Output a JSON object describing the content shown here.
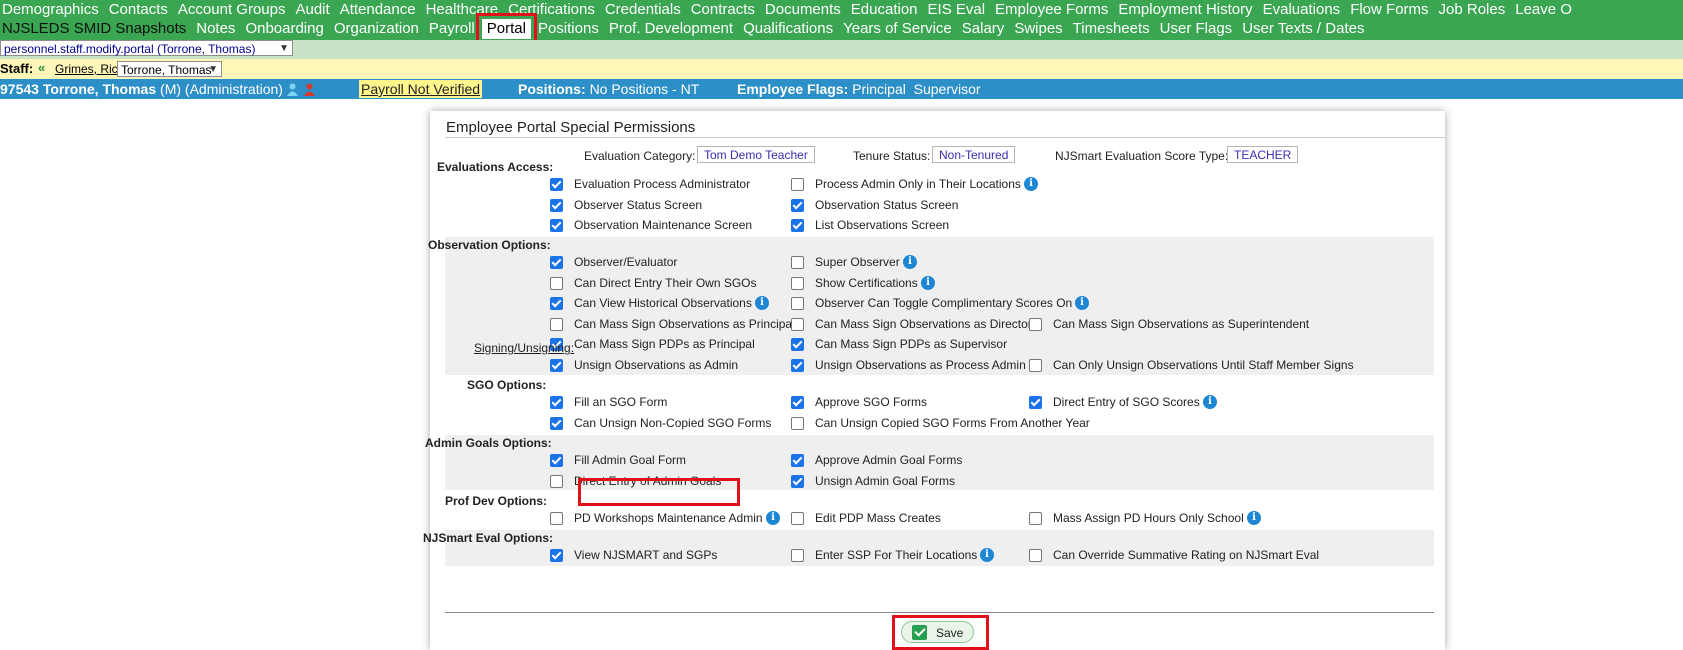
{
  "nav": {
    "row1": [
      "Demographics",
      "Contacts",
      "Account Groups",
      "Audit",
      "Attendance",
      "Healthcare",
      "Certifications",
      "Credentials",
      "Contracts",
      "Documents",
      "Education",
      "EIS Eval",
      "Employee Forms",
      "Employment History",
      "Evaluations",
      "Flow Forms",
      "Job Roles",
      "Leave O"
    ],
    "row2_brand": "NJSLEDS SMID Snapshots",
    "row2": [
      "Notes",
      "Onboarding",
      "Organization",
      "Payroll",
      "Portal",
      "Positions",
      "Prof. Development",
      "Qualifications",
      "Years of Service",
      "Salary",
      "Swipes",
      "Timesheets",
      "User Flags",
      "User Texts / Dates"
    ],
    "active_tab": "Portal"
  },
  "page_select": "personnel.staff.modify.portal (Torrone, Thomas)",
  "staff_bar": {
    "label": "Staff:",
    "prev_link": "Grimes, Rick",
    "selected": "Torrone, Thomas"
  },
  "employee_bar": {
    "id_name": "97543 Torrone, Thomas",
    "rest": "(M) (Administration)",
    "payroll_status": "Payroll Not Verified",
    "positions_label": "Positions:",
    "positions_value": "No Positions - NT",
    "flags_label": "Employee Flags:",
    "flags_value": "Principal  Supervisor"
  },
  "panel": {
    "title": "Employee Portal Special Permissions",
    "eval_category_label": "Evaluation Category:",
    "eval_category_value": "Tom Demo Teacher",
    "tenure_label": "Tenure Status:",
    "tenure_value": "Non-Tenured",
    "score_type_label": "NJSmart Evaluation Score Type:",
    "score_type_value": "TEACHER",
    "signing_link": "Signing/Unsigning:",
    "sections": [
      {
        "title": "Evaluations Access:",
        "rows": [
          [
            {
              "label": "Evaluation Process Administrator",
              "checked": true
            },
            {
              "label": "Process Admin Only in Their Locations",
              "checked": false,
              "info": true
            }
          ],
          [
            {
              "label": "Observer Status Screen",
              "checked": true
            },
            {
              "label": "Observation Status Screen",
              "checked": true
            }
          ],
          [
            {
              "label": "Observation Maintenance Screen",
              "checked": true
            },
            {
              "label": "List Observations Screen",
              "checked": true
            }
          ]
        ]
      },
      {
        "title": "Observation Options:",
        "rows": [
          [
            {
              "label": "Observer/Evaluator",
              "checked": true
            },
            {
              "label": "Super Observer",
              "checked": false,
              "info": true
            }
          ],
          [
            {
              "label": "Can Direct Entry Their Own SGOs",
              "checked": false
            },
            {
              "label": "Show Certifications",
              "checked": false,
              "info": true
            }
          ],
          [
            {
              "label": "Can View Historical Observations",
              "checked": true,
              "info": true
            },
            {
              "label": "Observer Can Toggle Complimentary Scores On",
              "checked": false,
              "info": true
            }
          ],
          [
            {
              "label": "Can Mass Sign Observations as Principal",
              "checked": false
            },
            {
              "label": "Can Mass Sign Observations as Director",
              "checked": false
            },
            {
              "label": "Can Mass Sign Observations as Superintendent",
              "checked": false
            }
          ],
          [
            {
              "label": "Can Mass Sign PDPs as Principal",
              "checked": true
            },
            {
              "label": "Can Mass Sign PDPs as Supervisor",
              "checked": true
            }
          ],
          [
            {
              "label": "Unsign Observations as Admin",
              "checked": true
            },
            {
              "label": "Unsign Observations as Process Admin",
              "checked": true
            },
            {
              "label": "Can Only Unsign Observations Until Staff Member Signs",
              "checked": false
            }
          ]
        ]
      },
      {
        "title": "SGO Options:",
        "rows": [
          [
            {
              "label": "Fill an SGO Form",
              "checked": true
            },
            {
              "label": "Approve SGO Forms",
              "checked": true
            },
            {
              "label": "Direct Entry of SGO Scores",
              "checked": true,
              "info": true
            }
          ],
          [
            {
              "label": "Can Unsign Non-Copied SGO Forms",
              "checked": true
            },
            {
              "label": "Can Unsign Copied SGO Forms From Another Year",
              "checked": false
            }
          ]
        ]
      },
      {
        "title": "Admin Goals Options:",
        "rows": [
          [
            {
              "label": "Fill Admin Goal Form",
              "checked": true
            },
            {
              "label": "Approve Admin Goal Forms",
              "checked": true
            }
          ],
          [
            {
              "label": "Direct Entry of Admin Goals",
              "checked": false
            },
            {
              "label": "Unsign Admin Goal Forms",
              "checked": true
            }
          ]
        ]
      },
      {
        "title": "Prof Dev Options:",
        "rows": [
          [
            {
              "label": "PD Workshops Maintenance Admin",
              "checked": false,
              "info": true
            },
            {
              "label": "Edit PDP Mass Creates",
              "checked": false
            },
            {
              "label": "Mass Assign PD Hours Only School",
              "checked": false,
              "info": true
            }
          ]
        ]
      },
      {
        "title": "NJSmart Eval Options:",
        "rows": [
          [
            {
              "label": "View NJSMART and SGPs",
              "checked": true
            },
            {
              "label": "Enter SSP For Their Locations",
              "checked": false,
              "info": true
            },
            {
              "label": "Can Override Summative Rating on NJSmart Eval",
              "checked": false
            }
          ]
        ]
      }
    ]
  },
  "save_label": "Save"
}
